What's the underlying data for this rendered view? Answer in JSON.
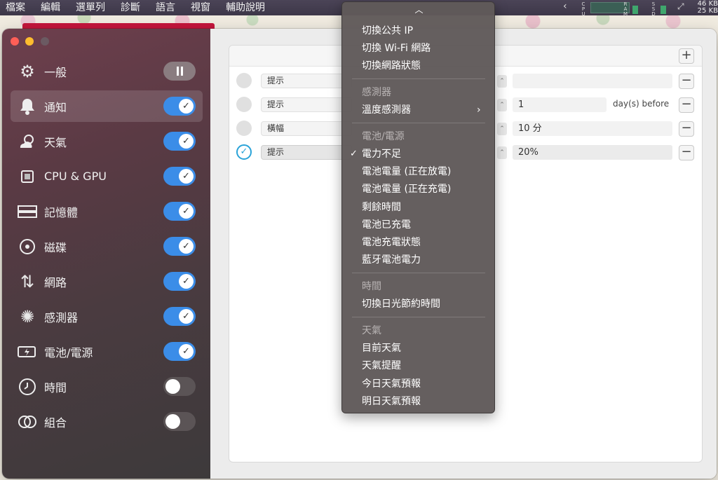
{
  "menubar": {
    "items": [
      "檔案",
      "編輯",
      "選單列",
      "診斷",
      "語言",
      "視窗",
      "輔助說明"
    ],
    "net_up": "46 KB",
    "net_down": "25 KB",
    "stat_labels": {
      "cpu": "CPU",
      "ram": "RAM",
      "ssd": "SSD"
    }
  },
  "sidebar": {
    "items": [
      {
        "label": "一般",
        "icon": "gear-icon",
        "toggle": "pause"
      },
      {
        "label": "通知",
        "icon": "bell-icon",
        "toggle": "on",
        "selected": true
      },
      {
        "label": "天氣",
        "icon": "weather-icon",
        "toggle": "on"
      },
      {
        "label": "CPU & GPU",
        "icon": "chip-icon",
        "toggle": "on"
      },
      {
        "label": "記憶體",
        "icon": "memory-icon",
        "toggle": "on"
      },
      {
        "label": "磁碟",
        "icon": "disk-icon",
        "toggle": "on"
      },
      {
        "label": "網路",
        "icon": "network-icon",
        "toggle": "on"
      },
      {
        "label": "感測器",
        "icon": "fan-icon",
        "toggle": "on"
      },
      {
        "label": "電池/電源",
        "icon": "battery-icon",
        "toggle": "on"
      },
      {
        "label": "時間",
        "icon": "clock-icon",
        "toggle": "off"
      },
      {
        "label": "組合",
        "icon": "combine-icon",
        "toggle": "off"
      }
    ]
  },
  "rules": [
    {
      "type": "提示",
      "value": "",
      "after": "",
      "checked": false
    },
    {
      "type": "提示",
      "value": "1",
      "after": "day(s) before",
      "checked": false
    },
    {
      "type": "橫幅",
      "value": "10 分",
      "after": "",
      "checked": false
    },
    {
      "type": "提示",
      "value": "20%",
      "after": "",
      "checked": true
    }
  ],
  "dropdown": {
    "items": [
      {
        "kind": "item",
        "label": "切換公共 IP"
      },
      {
        "kind": "item",
        "label": "切換 Wi-Fi 網路"
      },
      {
        "kind": "item",
        "label": "切換網路狀態"
      },
      {
        "kind": "header",
        "label": "感測器"
      },
      {
        "kind": "item",
        "label": "溫度感測器",
        "submenu": true
      },
      {
        "kind": "header",
        "label": "電池/電源"
      },
      {
        "kind": "item",
        "label": "電力不足",
        "checked": true
      },
      {
        "kind": "item",
        "label": "電池電量 (正在放電)"
      },
      {
        "kind": "item",
        "label": "電池電量 (正在充電)"
      },
      {
        "kind": "item",
        "label": "剩餘時間"
      },
      {
        "kind": "item",
        "label": "電池已充電"
      },
      {
        "kind": "item",
        "label": "電池充電狀態"
      },
      {
        "kind": "item",
        "label": "藍牙電池電力"
      },
      {
        "kind": "header",
        "label": "時間"
      },
      {
        "kind": "item",
        "label": "切換日光節約時間"
      },
      {
        "kind": "header",
        "label": "天氣"
      },
      {
        "kind": "item",
        "label": "目前天氣"
      },
      {
        "kind": "item",
        "label": "天氣提醒"
      },
      {
        "kind": "item",
        "label": "今日天氣預報"
      },
      {
        "kind": "item",
        "label": "明日天氣預報"
      }
    ]
  },
  "colors": {
    "accent": "#3b8de8",
    "check": "#2aa3d8",
    "sidebar_top": "#6e3f4d"
  }
}
